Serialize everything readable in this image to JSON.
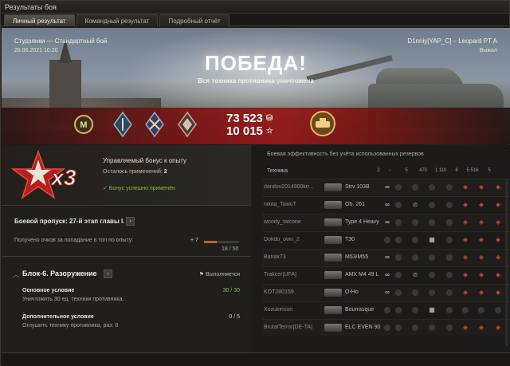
{
  "window": {
    "title": "Результаты боя",
    "close_icon": "close-icon"
  },
  "tabs": [
    {
      "label": "Личный результат",
      "active": true
    },
    {
      "label": "Командный результат",
      "active": false
    },
    {
      "label": "Подробный отчёт",
      "active": false
    }
  ],
  "hero": {
    "map_mode": "Студзянки — Стандартный бой",
    "date": "28.06.2021 10:20",
    "player": "D1nniy[YAP_C] – Leopard PT A",
    "status": "Выжил",
    "result": "ПОБЕДА!",
    "result_sub": "Вся техника противника уничтожена",
    "credits": "73 523",
    "xp": "10 015",
    "medals": [
      "mastery-m-icon",
      "medal-shield-icon",
      "medal-crossed-icon",
      "medal-diamond-icon"
    ],
    "badge_icon": "tank-badge-icon"
  },
  "bonus": {
    "multiplier": "x3",
    "title": "Управляемый бонус к опыту",
    "remaining_label": "Осталось применений:",
    "remaining_value": "2",
    "applied": "✓ Бонус успешно применён"
  },
  "battle_pass": {
    "title": "Боевой пропуск: 27-й этап главы I.",
    "points_label": "Получено очков за попадание в топ по опыту:",
    "points_plus": "+ 7",
    "progress": "18 / 50",
    "progress_fraction": 0.36
  },
  "mission": {
    "title": "Блок-6. Разоружение",
    "status": "Выполняется",
    "main_title": "Основное условие",
    "main_desc": "Уничтожить 30 ед. техники противника.",
    "main_value": "30 / 30",
    "extra_title": "Дополнительное условие",
    "extra_desc": "Оглушить технику противника, раз: 8",
    "extra_value": "0 / 5",
    "accent": "#7fbf4f"
  },
  "efficiency": {
    "title": "Боевая эффективность без учёта использованных резервов",
    "col_vehicle": "Техника",
    "columns": [
      "2",
      "-",
      "5",
      "470",
      "1 110",
      "6",
      "5 516",
      "5"
    ],
    "rows": [
      {
        "player": "danilov2014000kir...",
        "tank": "Strv 103B",
        "icons": [
          "spot",
          "",
          "",
          "",
          "",
          "dmg",
          "dmg",
          "dmg"
        ]
      },
      {
        "player": "nikita_TawuT",
        "tank": "Об. 261",
        "icons": [
          "spot",
          "",
          "assist",
          "",
          "",
          "dmg",
          "dmg",
          "dmg"
        ]
      },
      {
        "player": "woody_falcone",
        "tank": "Type 4 Heavy",
        "icons": [
          "spot",
          "",
          "",
          "",
          "",
          "dmg",
          "dmg",
          "dmg"
        ]
      },
      {
        "player": "Dokdo_own_2",
        "tank": "T30",
        "icons": [
          "",
          "",
          "",
          "hit",
          "",
          "dmg",
          "dmg",
          "dmg"
        ]
      },
      {
        "player": "Banax73",
        "tank": "M53/M55",
        "icons": [
          "spot",
          "",
          "",
          "",
          "",
          "dmg",
          "dmg",
          "dmg"
        ]
      },
      {
        "player": "Trakcer[UFA]",
        "tank": "AMX M4 49 L",
        "icons": [
          "spot",
          "",
          "assist",
          "",
          "",
          "dmg",
          "dmg",
          "dmg"
        ]
      },
      {
        "player": "KOT280159",
        "tank": "О-Но",
        "icons": [
          "spot",
          "",
          "",
          "",
          "",
          "dmg",
          "dmg",
          "dmg"
        ]
      },
      {
        "player": "Xozukinson",
        "tank": "Bourrasque",
        "icons": [
          "",
          "",
          "",
          "hit",
          "",
          "",
          "",
          ""
        ]
      },
      {
        "player": "BrutalTerror[DE-TA]",
        "tank": "ELC EVEN 90",
        "icons": [
          "",
          "",
          "",
          "",
          "",
          "dmg",
          "dmg",
          "dmg"
        ]
      }
    ]
  }
}
